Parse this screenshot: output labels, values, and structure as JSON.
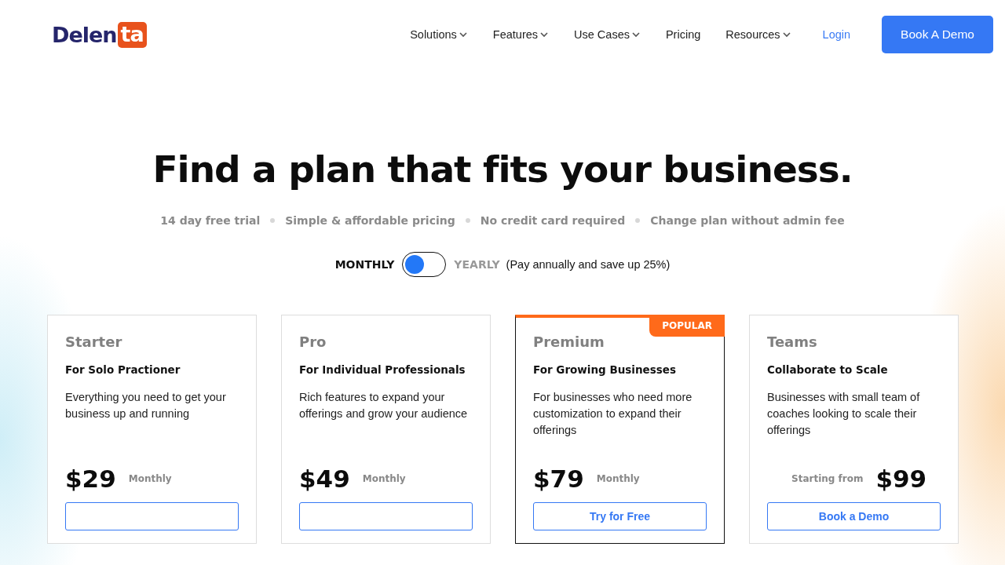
{
  "header": {
    "logo": {
      "part_1": "Delen",
      "part_2": "ta"
    },
    "nav": [
      {
        "label": "Solutions",
        "dropdown": true
      },
      {
        "label": "Features",
        "dropdown": true
      },
      {
        "label": "Use Cases",
        "dropdown": true
      },
      {
        "label": "Pricing",
        "dropdown": false
      },
      {
        "label": "Resources",
        "dropdown": true
      }
    ],
    "login": "Login",
    "cta": "Book A Demo"
  },
  "hero": {
    "title": "Find a plan that fits your business.",
    "perks": [
      "14 day free trial",
      "Simple  & affordable pricing",
      "No credit card required",
      "Change plan without admin fee"
    ],
    "billing": {
      "options": [
        {
          "label": "MONTHLY",
          "selected": true
        },
        {
          "label": "YEARLY",
          "selected": false
        }
      ],
      "note": "(Pay annually and save up 25%)"
    }
  },
  "plans": [
    {
      "name": "Starter",
      "tagline": "For Solo Practioner",
      "description": "Everything you need to get your business up and running",
      "price": "$29",
      "period": "Monthly",
      "popular": false
    },
    {
      "name": "Pro",
      "tagline": "For Individual Professionals",
      "description": "Rich features to expand your offerings and grow your audience",
      "price": "$49",
      "period": "Monthly",
      "popular": false
    },
    {
      "name": "Premium",
      "tagline": "For Growing Businesses",
      "description": "For businesses who need more customization to expand their offerings",
      "price": "$79",
      "period": "Monthly",
      "popular": true,
      "badge": "POPULAR",
      "button": "Try for Free"
    },
    {
      "name": "Teams",
      "tagline": "Collaborate to Scale",
      "description": "Businesses with small team of coaches looking to scale their offerings",
      "price": "$99",
      "prefix": "Starting from",
      "popular": false,
      "button": "Book a Demo"
    }
  ]
}
